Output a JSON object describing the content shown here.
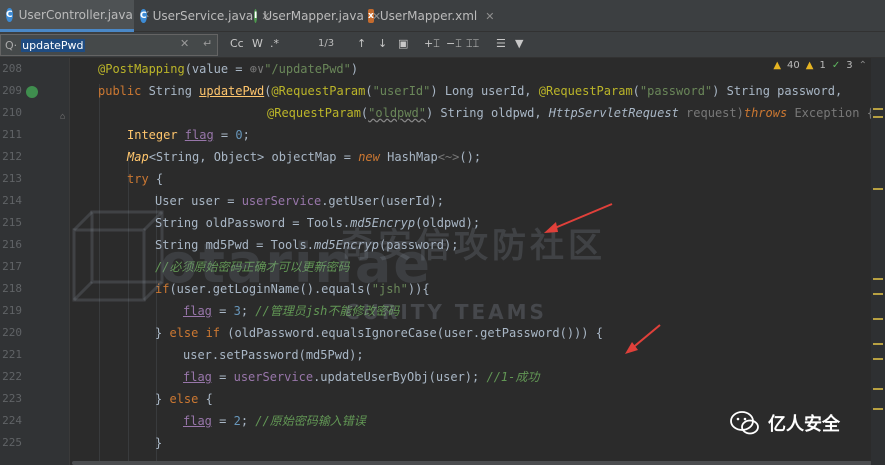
{
  "tabs": [
    {
      "label": "UserController.java",
      "icon": "class-c-icon",
      "active": true
    },
    {
      "label": "UserService.java",
      "icon": "class-c-icon",
      "active": false
    },
    {
      "label": "UserMapper.java",
      "icon": "interface-i-icon",
      "active": false
    },
    {
      "label": "UserMapper.xml",
      "icon": "xml-file-icon",
      "active": false
    }
  ],
  "search": {
    "value": "updatePwd",
    "match_count": "1/3",
    "case_label": "Cc",
    "word_label": "W"
  },
  "inspections": {
    "warnings": "40",
    "weak_warnings": "1",
    "ok": "3"
  },
  "line_numbers": [
    "208",
    "209",
    "210",
    "211",
    "212",
    "213",
    "214",
    "215",
    "216",
    "217",
    "218",
    "219",
    "220",
    "221",
    "222",
    "223",
    "224",
    "225"
  ],
  "code": {
    "l208": {
      "anno": "@PostMapping",
      "p1": "(value = ",
      "ghost": "⊕∨",
      "str": "\"/updatePwd\"",
      "p2": ")"
    },
    "l209": {
      "kw": "public ",
      "type": "String ",
      "fn": "updatePwd",
      "p1": "(",
      "a1": "@RequestParam",
      "p2": "(",
      "s1": "\"userId\"",
      "p3": ") Long userId, ",
      "a2": "@RequestParam",
      "p4": "(",
      "s2": "\"password\"",
      "p5": ") String password,"
    },
    "l210": {
      "a1": "@RequestParam",
      "p1": "(",
      "s1": "\"oldpwd\"",
      "p2": ") String oldpwd, ",
      "t1": "HttpServletRequest",
      "p3": " request)",
      "kw": "throws",
      "p4": " Exception {"
    },
    "l211": {
      "t1": "Integer ",
      "v": "flag",
      "p1": " = ",
      "n": "0",
      "p2": ";"
    },
    "l212": {
      "t1": "Map",
      "p1": "<String, Object> objectMap = ",
      "kw": "new",
      "p2": " HashMap",
      "ghost": "<~>",
      "p3": "();"
    },
    "l213": {
      "kw": "try",
      "p1": " {"
    },
    "l214": {
      "p1": "User user = ",
      "f": "userService",
      "p2": ".getUser(userId);"
    },
    "l215": {
      "p1": "String oldPassword = Tools.",
      "m": "md5Encryp",
      "p2": "(oldpwd);"
    },
    "l216": {
      "p1": "String md5Pwd = Tools.",
      "m": "md5Encryp",
      "p2": "(password);"
    },
    "l217": {
      "cm": "//必须原始密码正确才可以更新密码"
    },
    "l218": {
      "kw": "if",
      "p1": "(user.getLoginName().equals(",
      "s": "\"jsh\"",
      "p2": ")){"
    },
    "l219": {
      "v": "flag",
      "p1": " = ",
      "n": "3",
      "p2": "; ",
      "cm": "//管理员jsh不能修改密码"
    },
    "l220": {
      "p1": "} ",
      "kw": "else if",
      "p2": " (oldPassword.equalsIgnoreCase(user.getPassword())) {"
    },
    "l221": {
      "p1": "user.setPassword(md5Pwd);"
    },
    "l222": {
      "v": "flag",
      "p1": " = ",
      "f": "userService",
      "p2": ".updateUserByObj(user); ",
      "cm": "//1-成功"
    },
    "l223": {
      "p1": "} ",
      "kw": "else",
      "p2": " {"
    },
    "l224": {
      "v": "flag",
      "p1": " = ",
      "n": "2",
      "p2": "; ",
      "cm": "//原始密码输入错误"
    },
    "l225": {
      "p1": "}"
    }
  },
  "watermark": {
    "cn": "奇安信攻防社区",
    "en": "otarinae",
    "teams": "CURITY TEAMS"
  },
  "badge": {
    "label": "亿人安全"
  },
  "colors": {
    "accent": "#4a88c7",
    "arrow": "#e0403a",
    "keyword": "#cc7832",
    "string": "#6a8759",
    "annotation": "#bbb529"
  }
}
